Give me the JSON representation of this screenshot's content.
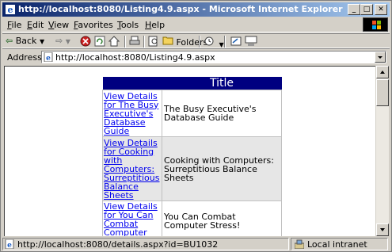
{
  "window": {
    "title": "http://localhost:8080/Listing4.9.aspx - Microsoft Internet Explorer",
    "btn_min": "_",
    "btn_max": "□",
    "btn_close": "✕"
  },
  "menu": {
    "items": [
      {
        "underline": "F",
        "rest": "ile"
      },
      {
        "underline": "E",
        "rest": "dit"
      },
      {
        "underline": "V",
        "rest": "iew"
      },
      {
        "underline": "F",
        "rest": "avorites",
        "prefix": ""
      },
      {
        "underline": "T",
        "rest": "ools"
      },
      {
        "underline": "H",
        "rest": "elp"
      }
    ]
  },
  "toolbar": {
    "back_label": "Back",
    "folders_label": "Folders"
  },
  "address": {
    "label": "Address",
    "url": "http://localhost:8080/Listing4.9.aspx"
  },
  "grid": {
    "header": {
      "col1": "",
      "col2": "Title"
    },
    "rows": [
      {
        "link": "View Details for The Busy Executive's Database Guide",
        "title": "The Busy Executive's Database Guide"
      },
      {
        "link": "View Details for Cooking with Computers: Surreptitious Balance Sheets",
        "title": "Cooking with Computers: Surreptitious Balance Sheets"
      },
      {
        "link": "View Details for You Can Combat Computer",
        "title": "You Can Combat Computer Stress!"
      }
    ]
  },
  "status": {
    "text": "http://localhost:8080/details.aspx?id=BU1032",
    "zone": "Local intranet"
  },
  "colors": {
    "titlebar_start": "#0a246a",
    "titlebar_end": "#a6caf0",
    "grid_header": "#000080",
    "link": "#0000ee",
    "alt_row": "#e6e6e6"
  }
}
